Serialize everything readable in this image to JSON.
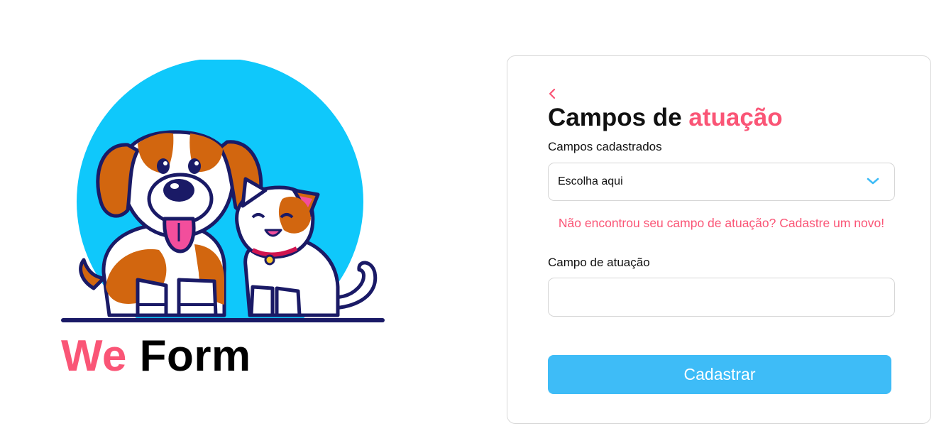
{
  "brand": {
    "part1": "We",
    "part2": "Form"
  },
  "illustration": {
    "name": "dog-and-cat-illustration",
    "circle_color": "#0fc8fb"
  },
  "form": {
    "back_icon": "chevron-left-icon",
    "title_part1": "Campos de ",
    "title_part2": "atuação",
    "registered_label": "Campos cadastrados",
    "select_value": "Escolha aqui",
    "select_icon": "chevron-down-icon",
    "hint_link": "Não encontrou seu campo de atuação? Cadastre um novo!",
    "field_label": "Campo de atuação",
    "field_value": "",
    "submit_label": "Cadastrar"
  },
  "colors": {
    "accent": "#fa5576",
    "primary_button": "#3ebcf7",
    "chevron": "#3ebcf7"
  }
}
